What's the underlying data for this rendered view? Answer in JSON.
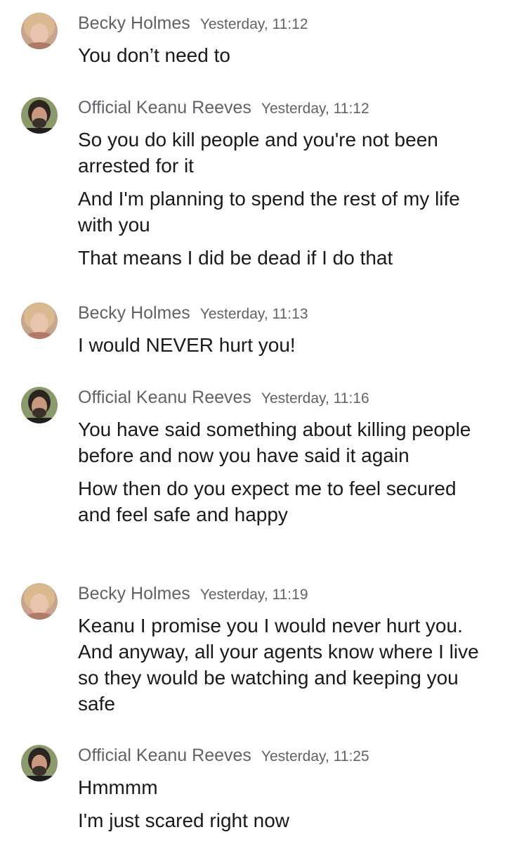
{
  "messages": [
    {
      "sender": "Becky Holmes",
      "time": "Yesterday, 11:12",
      "avatar": "becky-avatar",
      "lines": [
        "You don’t need to"
      ]
    },
    {
      "sender": "Official Keanu Reeves",
      "time": "Yesterday, 11:12",
      "avatar": "keanu-avatar",
      "lines": [
        "So you do kill people and you're not been arrested for it",
        "And I'm planning to spend the rest of my life with you",
        "That means I did be dead if I do that"
      ]
    },
    {
      "sender": "Becky Holmes",
      "time": "Yesterday, 11:13",
      "avatar": "becky-avatar",
      "lines": [
        "I would NEVER hurt you!"
      ]
    },
    {
      "sender": "Official Keanu Reeves",
      "time": "Yesterday, 11:16",
      "avatar": "keanu-avatar",
      "lines": [
        "You have said something about killing people before and now you have said it again",
        "How then do you expect me to feel secured and feel safe and happy"
      ]
    },
    {
      "sender": "Becky Holmes",
      "time": "Yesterday, 11:19",
      "avatar": "becky-avatar",
      "lines": [
        "Keanu I promise you I would never hurt you. And anyway, all your agents know where I live so they would be watching and keeping you safe"
      ]
    },
    {
      "sender": "Official Keanu Reeves",
      "time": "Yesterday, 11:25",
      "avatar": "keanu-avatar",
      "lines": [
        "Hmmmm",
        "I'm just scared right now"
      ]
    }
  ],
  "colors": {
    "sender_text": "#5f6368",
    "message_text": "#1a1a1a",
    "background": "#ffffff"
  }
}
